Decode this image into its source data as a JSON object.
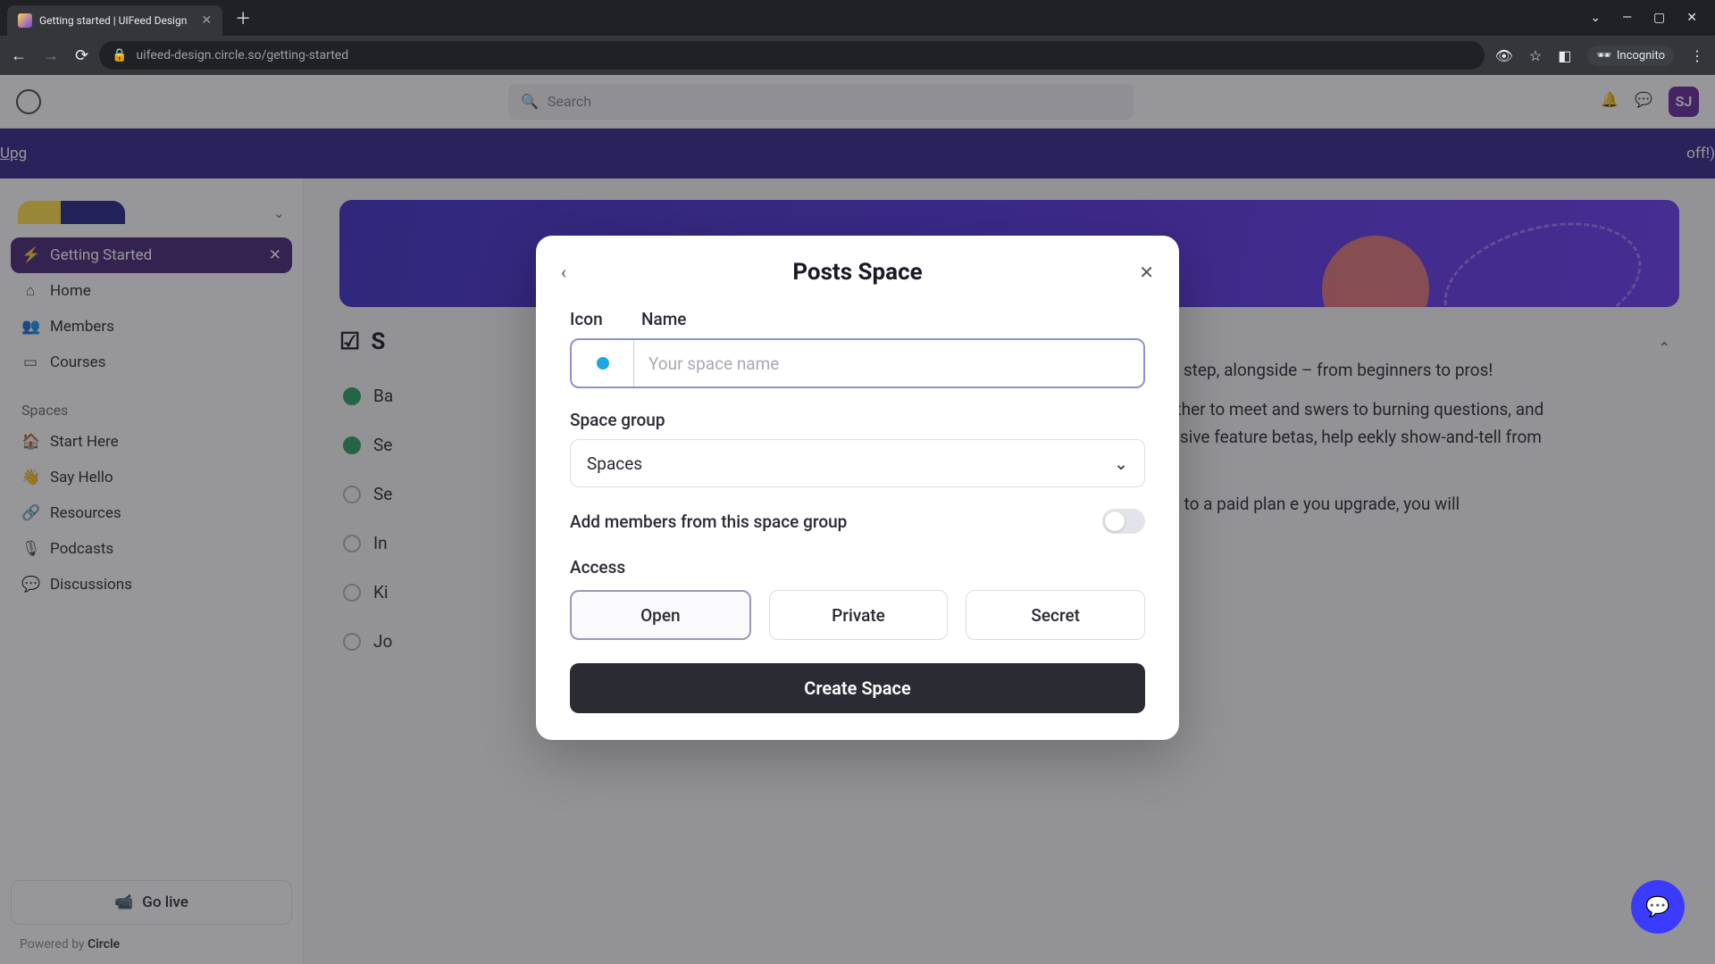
{
  "browser": {
    "tab_title": "Getting started | UIFeed Design",
    "url": "uifeed-design.circle.so/getting-started",
    "incognito_label": "Incognito"
  },
  "topbar": {
    "search_placeholder": "Search",
    "avatar_initials": "SJ"
  },
  "banner": {
    "text_left": "Upg",
    "text_right": "off!)"
  },
  "sidebar": {
    "items": [
      {
        "icon": "⚡",
        "label": "Getting Started",
        "active": true
      },
      {
        "icon": "⌂",
        "label": "Home"
      },
      {
        "icon": "👥",
        "label": "Members"
      },
      {
        "icon": "▭",
        "label": "Courses"
      }
    ],
    "section_label": "Spaces",
    "spaces": [
      {
        "icon": "🏠",
        "label": "Start Here"
      },
      {
        "icon": "👋",
        "label": "Say Hello"
      },
      {
        "icon": "🔗",
        "label": "Resources"
      },
      {
        "icon": "🎙",
        "label": "Podcasts"
      },
      {
        "icon": "💬",
        "label": "Discussions"
      }
    ],
    "go_live": "Go live",
    "powered_prefix": "Powered by ",
    "powered_brand": "Circle"
  },
  "main": {
    "heading_prefix": "S",
    "checklist": [
      {
        "done": true,
        "label": "Ba"
      },
      {
        "done": true,
        "label": "Se"
      },
      {
        "done": false,
        "label": "Se"
      },
      {
        "done": false,
        "label": "In"
      },
      {
        "done": false,
        "label": "Ki"
      },
      {
        "done": false,
        "label": "Jo"
      }
    ],
    "desc": {
      "p1": "d your community, step by step, alongside – from beginners to pros!",
      "p2": "eators like you come together to meet and swers to burning questions, and build have access to exclusive feature betas, help eekly show-and-tell from other creators.",
      "p3": "y, you will need to upgrade to a paid plan e you upgrade, you will automatically munity."
    }
  },
  "modal": {
    "title": "Posts Space",
    "icon_label": "Icon",
    "name_label": "Name",
    "name_placeholder": "Your space name",
    "group_label": "Space group",
    "group_value": "Spaces",
    "add_members_label": "Add members from this space group",
    "access_label": "Access",
    "access_options": [
      "Open",
      "Private",
      "Secret"
    ],
    "access_selected": "Open",
    "submit": "Create Space"
  }
}
